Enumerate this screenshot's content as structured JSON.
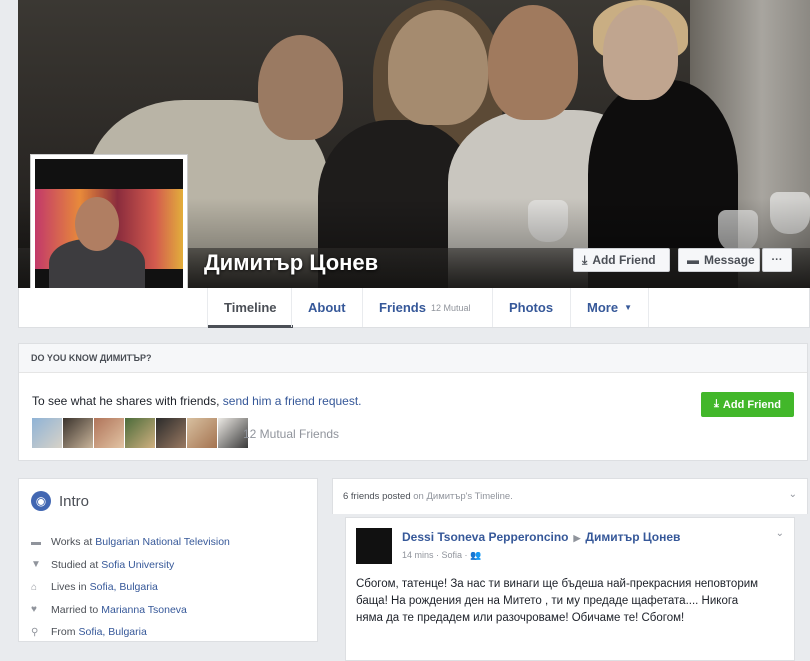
{
  "profile": {
    "name": "Димитър Цонев"
  },
  "cover_actions": {
    "add_friend": "Add Friend",
    "message": "Message",
    "more": "···"
  },
  "nav": {
    "tabs": [
      {
        "label": "Timeline"
      },
      {
        "label": "About"
      },
      {
        "label": "Friends",
        "sub": "12 Mutual"
      },
      {
        "label": "Photos"
      },
      {
        "label": "More",
        "caret": "▼"
      }
    ]
  },
  "know_box": {
    "heading": "DO YOU KNOW ДИМИТЪР?",
    "text_prefix": "To see what he shares with friends, ",
    "link": "send him a friend request.",
    "mutual_friends": "12 Mutual Friends",
    "button": "Add Friend"
  },
  "intro": {
    "title": "Intro",
    "items": [
      {
        "icon": "briefcase-icon",
        "prefix": "Works at",
        "link": "Bulgarian National Television"
      },
      {
        "icon": "graduation-cap-icon",
        "prefix": "Studied at",
        "link": "Sofia University"
      },
      {
        "icon": "home-icon",
        "prefix": "Lives in",
        "link": "Sofia, Bulgaria"
      },
      {
        "icon": "heart-icon",
        "prefix": "Married to",
        "link": "Marianna Tsoneva"
      },
      {
        "icon": "location-pin-icon",
        "prefix": "From",
        "link": "Sofia, Bulgaria"
      }
    ]
  },
  "posts": {
    "header_count": "6 friends",
    "header_posted": "posted",
    "header_rest": "on Димитър's Timeline.",
    "items": [
      {
        "author": "Dessi Tsoneva Pepperoncino",
        "target": "Димитър Цонев",
        "time": "14 mins",
        "place": "Sofia",
        "body": "Сбогом, татенце! За нас ти винаги ще бъдеша най-прекрасния неповторим баща! На рождения ден на Митето , ти му предаде щафетата.... Никога няма да те предадем или разочроваме! Обичаме те! Сбогом!"
      }
    ]
  },
  "colors": {
    "link": "#365899",
    "green": "#42b72a",
    "muted": "#90949c",
    "page_bg": "#e9ebee"
  }
}
